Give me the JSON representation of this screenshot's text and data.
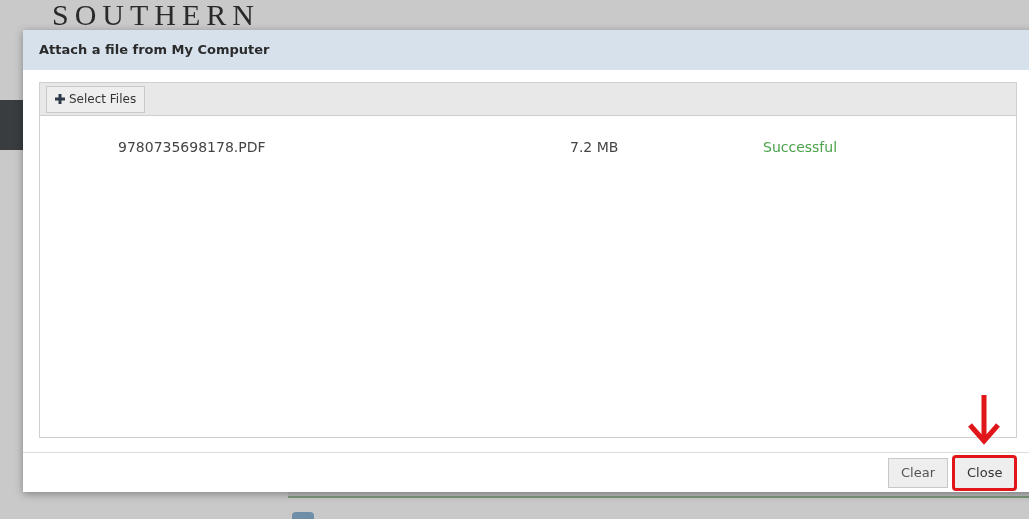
{
  "background": {
    "title": "SOUTHERN"
  },
  "dialog": {
    "title": "Attach a file from My Computer",
    "toolbar": {
      "button": "Select Files"
    },
    "files": [
      {
        "name": "9780735698178.PDF",
        "size": "7.2 MB",
        "status": "Successful",
        "kind": "success"
      }
    ],
    "buttons": [
      {
        "label": "Clear",
        "highlighted": false
      },
      {
        "label": "Close",
        "highlighted": true
      }
    ]
  }
}
